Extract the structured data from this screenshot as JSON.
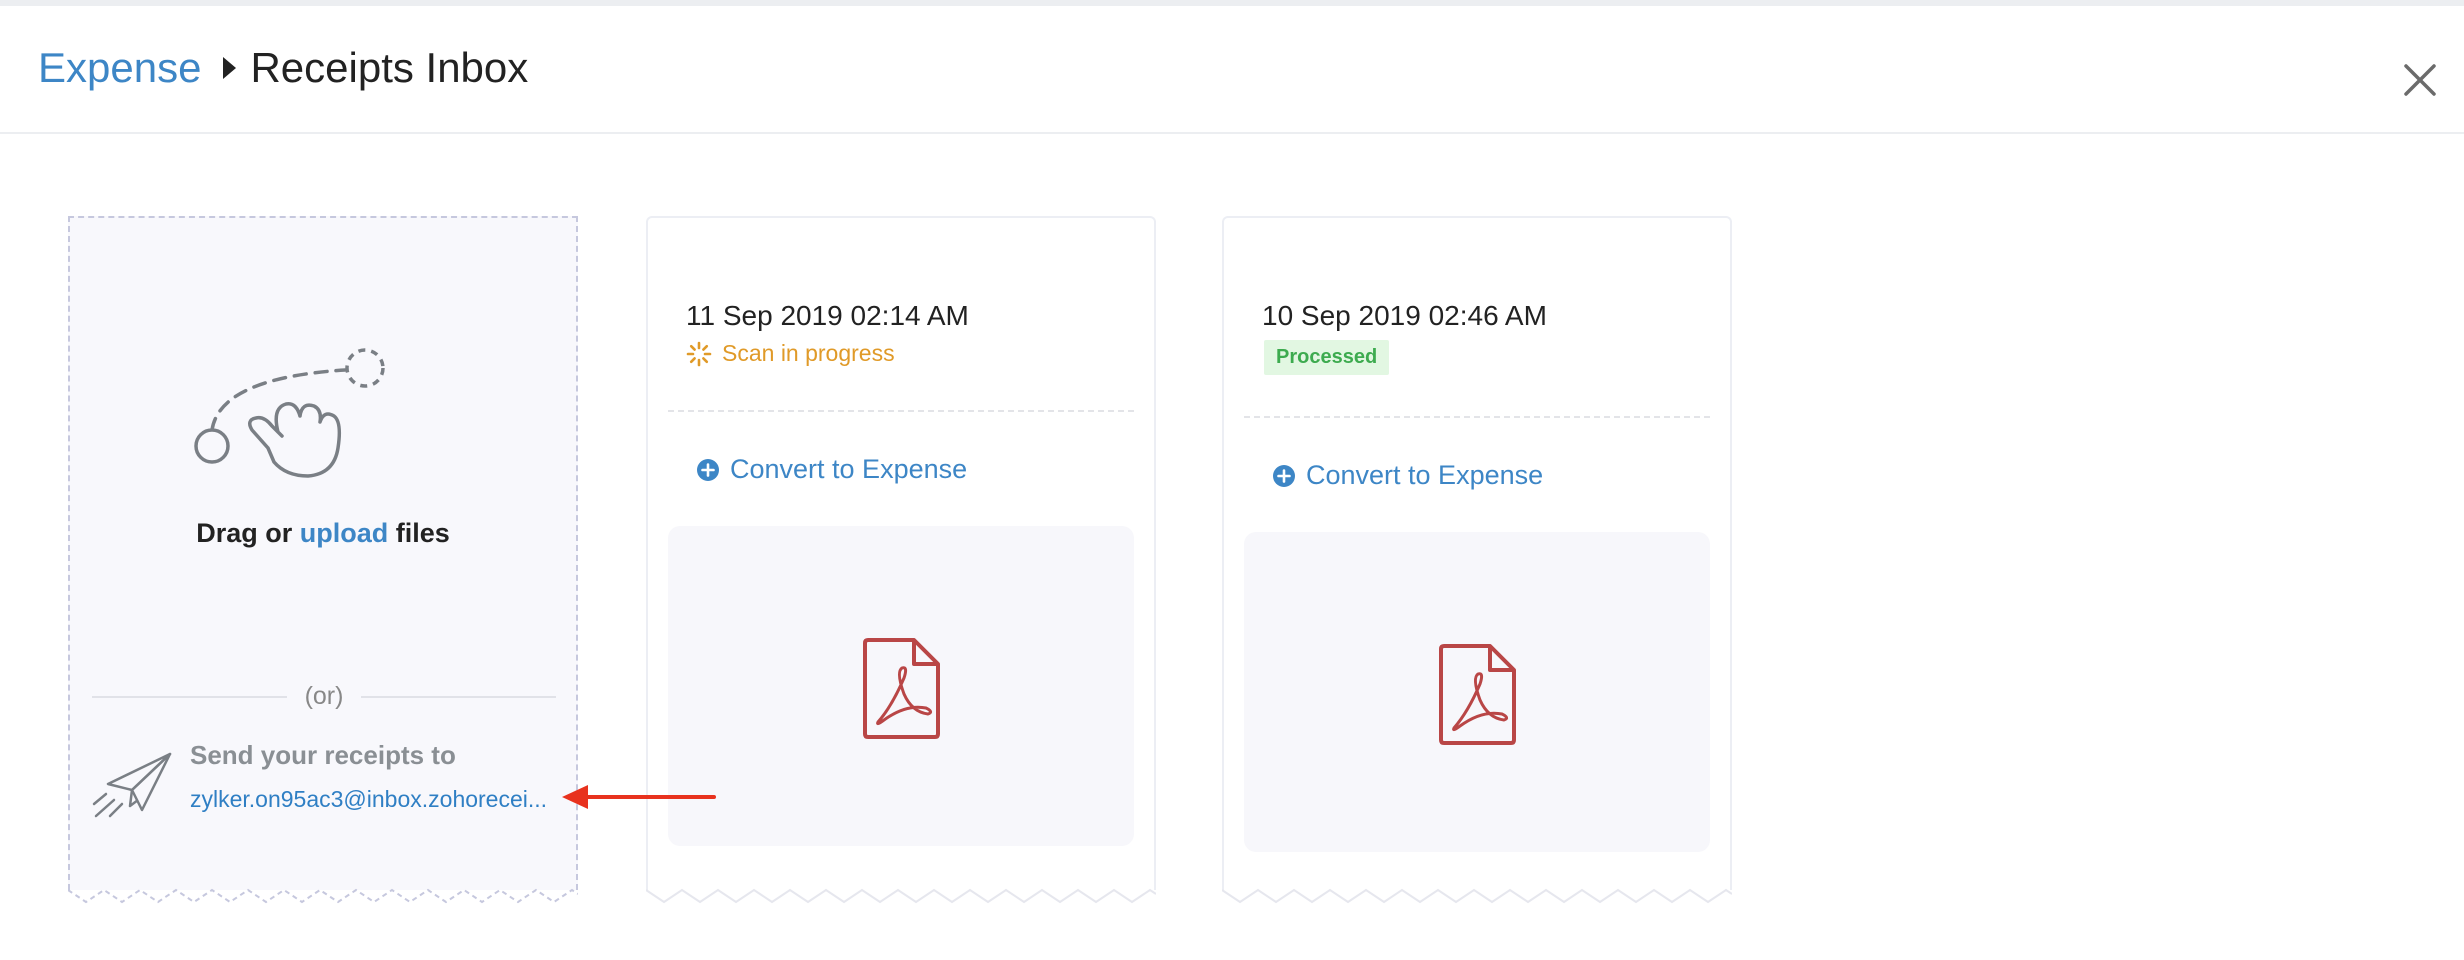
{
  "header": {
    "breadcrumb_parent": "Expense",
    "breadcrumb_current": "Receipts Inbox"
  },
  "upload_card": {
    "drag_prefix": "Drag or",
    "upload_link": "upload",
    "drag_suffix": "files",
    "or_text": "(or)",
    "send_label": "Send your receipts to",
    "email": "zylker.on95ac3@inbox.zohoreceipts.com",
    "email_display": "zylker.on95ac3@inbox.zohorecei..."
  },
  "receipts": [
    {
      "date": "11 Sep 2019 02:14 AM",
      "status": "Scan in progress",
      "action_label": "Convert to Expense"
    },
    {
      "date": "10 Sep 2019 02:46 AM",
      "status": "Processed",
      "action_label": "Convert to Expense"
    }
  ],
  "colors": {
    "accent": "#3d86c6",
    "scan_in_progress": "#e09a28",
    "processed_text": "#3dab4f",
    "processed_bg": "#e2f7e2",
    "pdf_icon": "#b94646",
    "annotation_arrow": "#e8321e"
  },
  "icons": [
    "close-icon",
    "drag-gesture-icon",
    "paper-plane-icon",
    "spinner-icon",
    "plus-circle-icon",
    "pdf-file-icon"
  ]
}
